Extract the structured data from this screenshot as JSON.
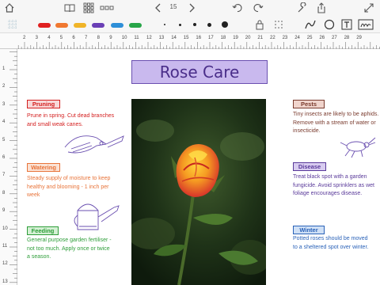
{
  "toolbar": {
    "icons": [
      "home-icon",
      "book-icon",
      "grid-icon",
      "more-icon",
      "chevron-left-icon",
      "chevron-right-icon",
      "undo-icon",
      "redo-icon",
      "wrench-icon",
      "share-icon",
      "expand-icon"
    ],
    "page_number": "15"
  },
  "pen_colors": [
    "#e02020",
    "#f07830",
    "#f0b428",
    "#6a3fb5",
    "#2e8fd8",
    "#27a548"
  ],
  "pen_sizes": [
    "thinnest",
    "thin",
    "medium",
    "thick",
    "thickest"
  ],
  "tools": [
    "lock-icon",
    "lasso-icon",
    "pen-tool-icon",
    "shape-icon",
    "text-box-icon",
    "handwriting-icon"
  ],
  "ruler": {
    "top": [
      "2",
      "3",
      "4",
      "5",
      "6",
      "7",
      "8",
      "9",
      "10",
      "11",
      "12",
      "13",
      "14",
      "15",
      "16",
      "17",
      "18",
      "19",
      "20",
      "21",
      "22",
      "23",
      "24",
      "25",
      "26",
      "27",
      "28",
      "29"
    ],
    "left": [
      "1",
      "2",
      "3",
      "4",
      "5",
      "6",
      "7",
      "8",
      "9",
      "10",
      "11",
      "12",
      "13"
    ]
  },
  "page": {
    "title": "Rose Care",
    "sections": {
      "pruning": {
        "label": "Pruning",
        "text": "Prune in spring. Cut dead branches and small weak canes."
      },
      "watering": {
        "label": "Watering",
        "text": "Steady supply of moisture to keep healthy and blooming - 1 inch per week"
      },
      "feeding": {
        "label": "Feeding",
        "text": "General purpose garden fertiliser - not too much. Apply once or twice a season."
      },
      "pests": {
        "label": "Pests",
        "text": "Tiny insects are likely to be aphids. Remove with a stream of water or insecticide."
      },
      "disease": {
        "label": "Disease",
        "text": "Treat black spot with a garden fungicide. Avoid sprinklers as wet foliage encourages disease."
      },
      "winter": {
        "label": "Winter",
        "text": "Potted roses should be moved to a sheltered spot over winter."
      }
    }
  },
  "colors": {
    "pruning": "#d42020",
    "watering": "#e8743a",
    "feeding": "#2f9e3a",
    "pests": "#7a3b2e",
    "disease": "#5a3a9a",
    "winter": "#2a62b8"
  }
}
